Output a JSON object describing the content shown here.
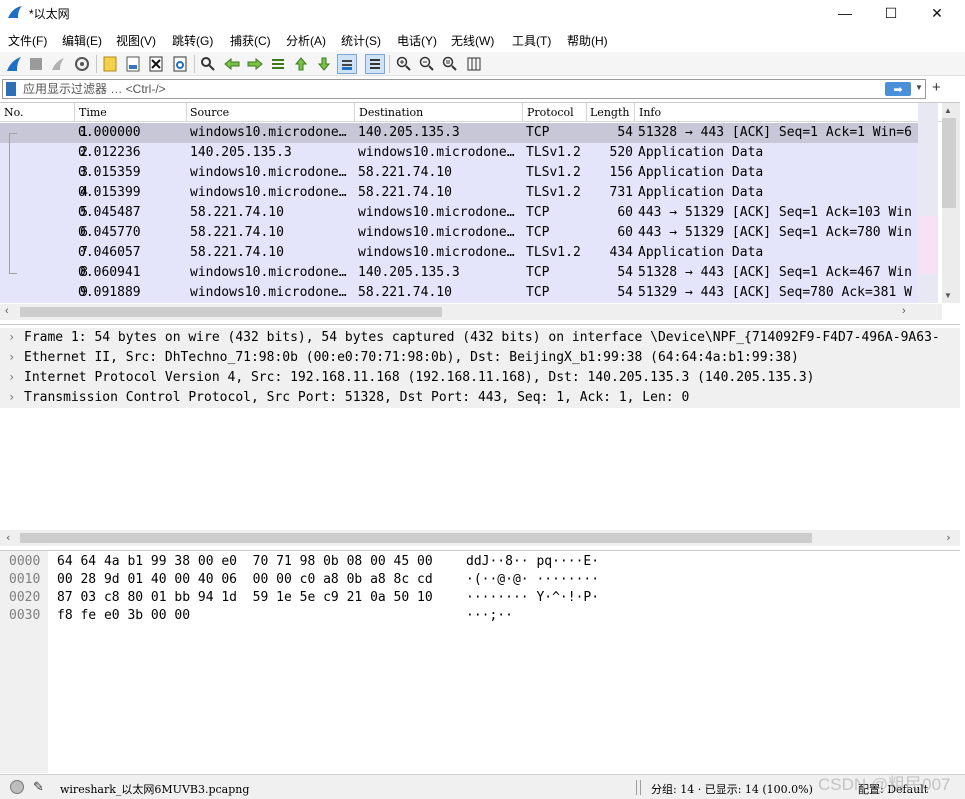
{
  "window": {
    "title": "*以太网",
    "min_glyph": "—",
    "max_glyph": "☐",
    "close_glyph": "✕"
  },
  "menu": [
    "文件(F)",
    "编辑(E)",
    "视图(V)",
    "跳转(G)",
    "捕获(C)",
    "分析(A)",
    "统计(S)",
    "电话(Y)",
    "无线(W)",
    "工具(T)",
    "帮助(H)"
  ],
  "toolbar": {
    "icons": [
      "shark-fin-start-icon",
      "stop-capture-icon",
      "restart-capture-icon",
      "capture-options-icon",
      "open-file-icon",
      "save-file-icon",
      "close-file-icon",
      "reload-file-icon",
      "find-packet-icon",
      "go-back-icon",
      "go-forward-icon",
      "go-to-packet-icon",
      "go-first-icon",
      "go-last-icon",
      "auto-scroll-icon",
      "colorize-icon",
      "zoom-in-icon",
      "zoom-out-icon",
      "zoom-normal-icon",
      "resize-columns-icon"
    ]
  },
  "filter": {
    "placeholder": "应用显示过滤器 … <Ctrl-/>",
    "apply_glyph": "➡",
    "dropdown_glyph": "▼",
    "add_glyph": "+"
  },
  "packet_list": {
    "columns": [
      "No.",
      "Time",
      "Source",
      "Destination",
      "Protocol",
      "Length",
      "Info"
    ],
    "rows": [
      {
        "no": "1",
        "time": "0.000000",
        "src": "windows10.microdone…",
        "dst": "140.205.135.3",
        "proto": "TCP",
        "len": "54",
        "info": "51328 → 443 [ACK] Seq=1 Ack=1 Win=6",
        "selected": true
      },
      {
        "no": "2",
        "time": "0.012236",
        "src": "140.205.135.3",
        "dst": "windows10.microdone…",
        "proto": "TLSv1.2",
        "len": "520",
        "info": "Application Data"
      },
      {
        "no": "3",
        "time": "0.015359",
        "src": "windows10.microdone…",
        "dst": "58.221.74.10",
        "proto": "TLSv1.2",
        "len": "156",
        "info": "Application Data"
      },
      {
        "no": "4",
        "time": "0.015399",
        "src": "windows10.microdone…",
        "dst": "58.221.74.10",
        "proto": "TLSv1.2",
        "len": "731",
        "info": "Application Data"
      },
      {
        "no": "5",
        "time": "0.045487",
        "src": "58.221.74.10",
        "dst": "windows10.microdone…",
        "proto": "TCP",
        "len": "60",
        "info": "443 → 51329 [ACK] Seq=1 Ack=103 Win"
      },
      {
        "no": "6",
        "time": "0.045770",
        "src": "58.221.74.10",
        "dst": "windows10.microdone…",
        "proto": "TCP",
        "len": "60",
        "info": "443 → 51329 [ACK] Seq=1 Ack=780 Win"
      },
      {
        "no": "7",
        "time": "0.046057",
        "src": "58.221.74.10",
        "dst": "windows10.microdone…",
        "proto": "TLSv1.2",
        "len": "434",
        "info": "Application Data"
      },
      {
        "no": "8",
        "time": "0.060941",
        "src": "windows10.microdone…",
        "dst": "140.205.135.3",
        "proto": "TCP",
        "len": "54",
        "info": "51328 → 443 [ACK] Seq=1 Ack=467 Win"
      },
      {
        "no": "9",
        "time": "0.091889",
        "src": "windows10.microdone…",
        "dst": "58.221.74.10",
        "proto": "TCP",
        "len": "54",
        "info": "51329 → 443 [ACK] Seq=780 Ack=381 W"
      }
    ],
    "row_color": "#e4e4fa",
    "selected_color": "#c7c7d8"
  },
  "details": {
    "rows": [
      "Frame 1: 54 bytes on wire (432 bits), 54 bytes captured (432 bits) on interface \\Device\\NPF_{714092F9-F4D7-496A-9A63-",
      "Ethernet II, Src: DhTechno_71:98:0b (00:e0:70:71:98:0b), Dst: BeijingX_b1:99:38 (64:64:4a:b1:99:38)",
      "Internet Protocol Version 4, Src: 192.168.11.168 (192.168.11.168), Dst: 140.205.135.3 (140.205.135.3)",
      "Transmission Control Protocol, Src Port: 51328, Dst Port: 443, Seq: 1, Ack: 1, Len: 0"
    ],
    "expand_glyph": "›"
  },
  "bytes": {
    "rows": [
      {
        "offset": "0000",
        "hex": "64 64 4a b1 99 38 00 e0  70 71 98 0b 08 00 45 00",
        "ascii": "ddJ··8·· pq····E·"
      },
      {
        "offset": "0010",
        "hex": "00 28 9d 01 40 00 40 06  00 00 c0 a8 0b a8 8c cd",
        "ascii": "·(··@·@· ········"
      },
      {
        "offset": "0020",
        "hex": "87 03 c8 80 01 bb 94 1d  59 1e 5e c9 21 0a 50 10",
        "ascii": "········ Y·^·!·P·"
      },
      {
        "offset": "0030",
        "hex": "f8 fe e0 3b 00 00",
        "ascii": "···;··"
      }
    ]
  },
  "status": {
    "file": "wireshark_以太网6MUVB3.pcapng",
    "stats": "分组: 14 · 已显示: 14 (100.0%)",
    "profile": "配置: Default",
    "watermark": "CSDN @粗民007"
  }
}
